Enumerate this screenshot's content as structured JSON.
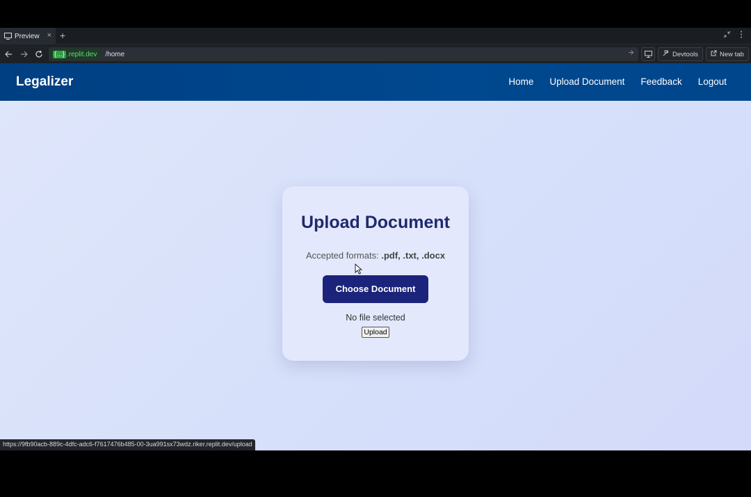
{
  "browser": {
    "tab_title": "Preview",
    "tab_close": "×",
    "new_tab_plus": "+",
    "url_host_brace": "{...}",
    "url_host": ".replit.dev",
    "url_path": "/home",
    "devtools_label": "Devtools",
    "newtab_label": "New tab",
    "status_url": "https://9fb90acb-889c-4dfc-adc6-f7617476b485-00-3ua991sx73wdz.riker.replit.dev/upload"
  },
  "app": {
    "brand": "Legalizer",
    "nav": [
      {
        "label": "Home"
      },
      {
        "label": "Upload Document"
      },
      {
        "label": "Feedback"
      },
      {
        "label": "Logout"
      }
    ],
    "card": {
      "title": "Upload Document",
      "formats_prefix": "Accepted formats: ",
      "formats_list": ".pdf, .txt, .docx",
      "choose_label": "Choose Document",
      "file_status": "No file selected",
      "upload_label": "Upload"
    }
  },
  "colors": {
    "nav_bg": "#00468c",
    "primary_button": "#1b237a",
    "title": "#1e2a6e",
    "card_bg": "#e3e8fd"
  }
}
